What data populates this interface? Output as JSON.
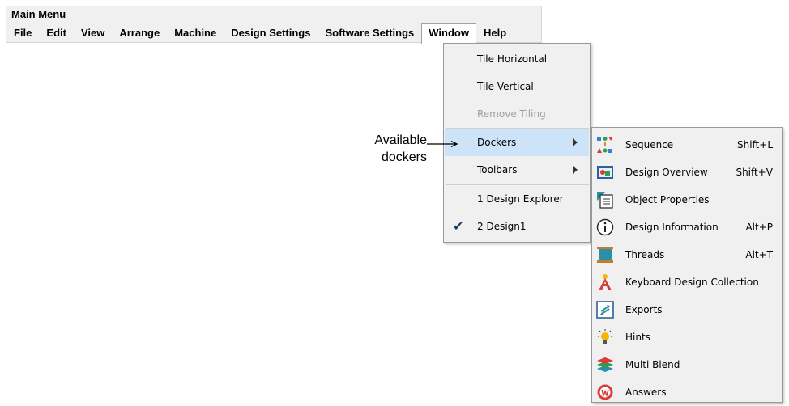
{
  "menubar": {
    "title": "Main Menu",
    "items": [
      "File",
      "Edit",
      "View",
      "Arrange",
      "Machine",
      "Design Settings",
      "Software Settings",
      "Window",
      "Help"
    ]
  },
  "window_menu": {
    "items": [
      {
        "label": "Tile Horizontal"
      },
      {
        "label": "Tile Vertical"
      },
      {
        "label": "Remove Tiling"
      },
      {
        "label": "Dockers"
      },
      {
        "label": "Toolbars"
      },
      {
        "label": "1 Design Explorer"
      },
      {
        "label": "2 Design1"
      }
    ]
  },
  "dockers_menu": {
    "items": [
      {
        "label": "Sequence",
        "shortcut": "Shift+L",
        "icon": "sequence-icon"
      },
      {
        "label": "Design Overview",
        "shortcut": "Shift+V",
        "icon": "design-overview-icon"
      },
      {
        "label": "Object Properties",
        "shortcut": "",
        "icon": "object-properties-icon"
      },
      {
        "label": "Design Information",
        "shortcut": "Alt+P",
        "icon": "info-icon"
      },
      {
        "label": "Threads",
        "shortcut": "Alt+T",
        "icon": "thread-spool-icon"
      },
      {
        "label": "Keyboard Design Collection",
        "shortcut": "",
        "icon": "keyboard-letter-icon"
      },
      {
        "label": "Exports",
        "shortcut": "",
        "icon": "exports-icon"
      },
      {
        "label": "Hints",
        "shortcut": "",
        "icon": "lightbulb-icon"
      },
      {
        "label": "Multi Blend",
        "shortcut": "",
        "icon": "multi-blend-icon"
      },
      {
        "label": "Answers",
        "shortcut": "",
        "icon": "answers-icon"
      }
    ]
  },
  "annotation": {
    "line1": "Available",
    "line2": "dockers"
  }
}
